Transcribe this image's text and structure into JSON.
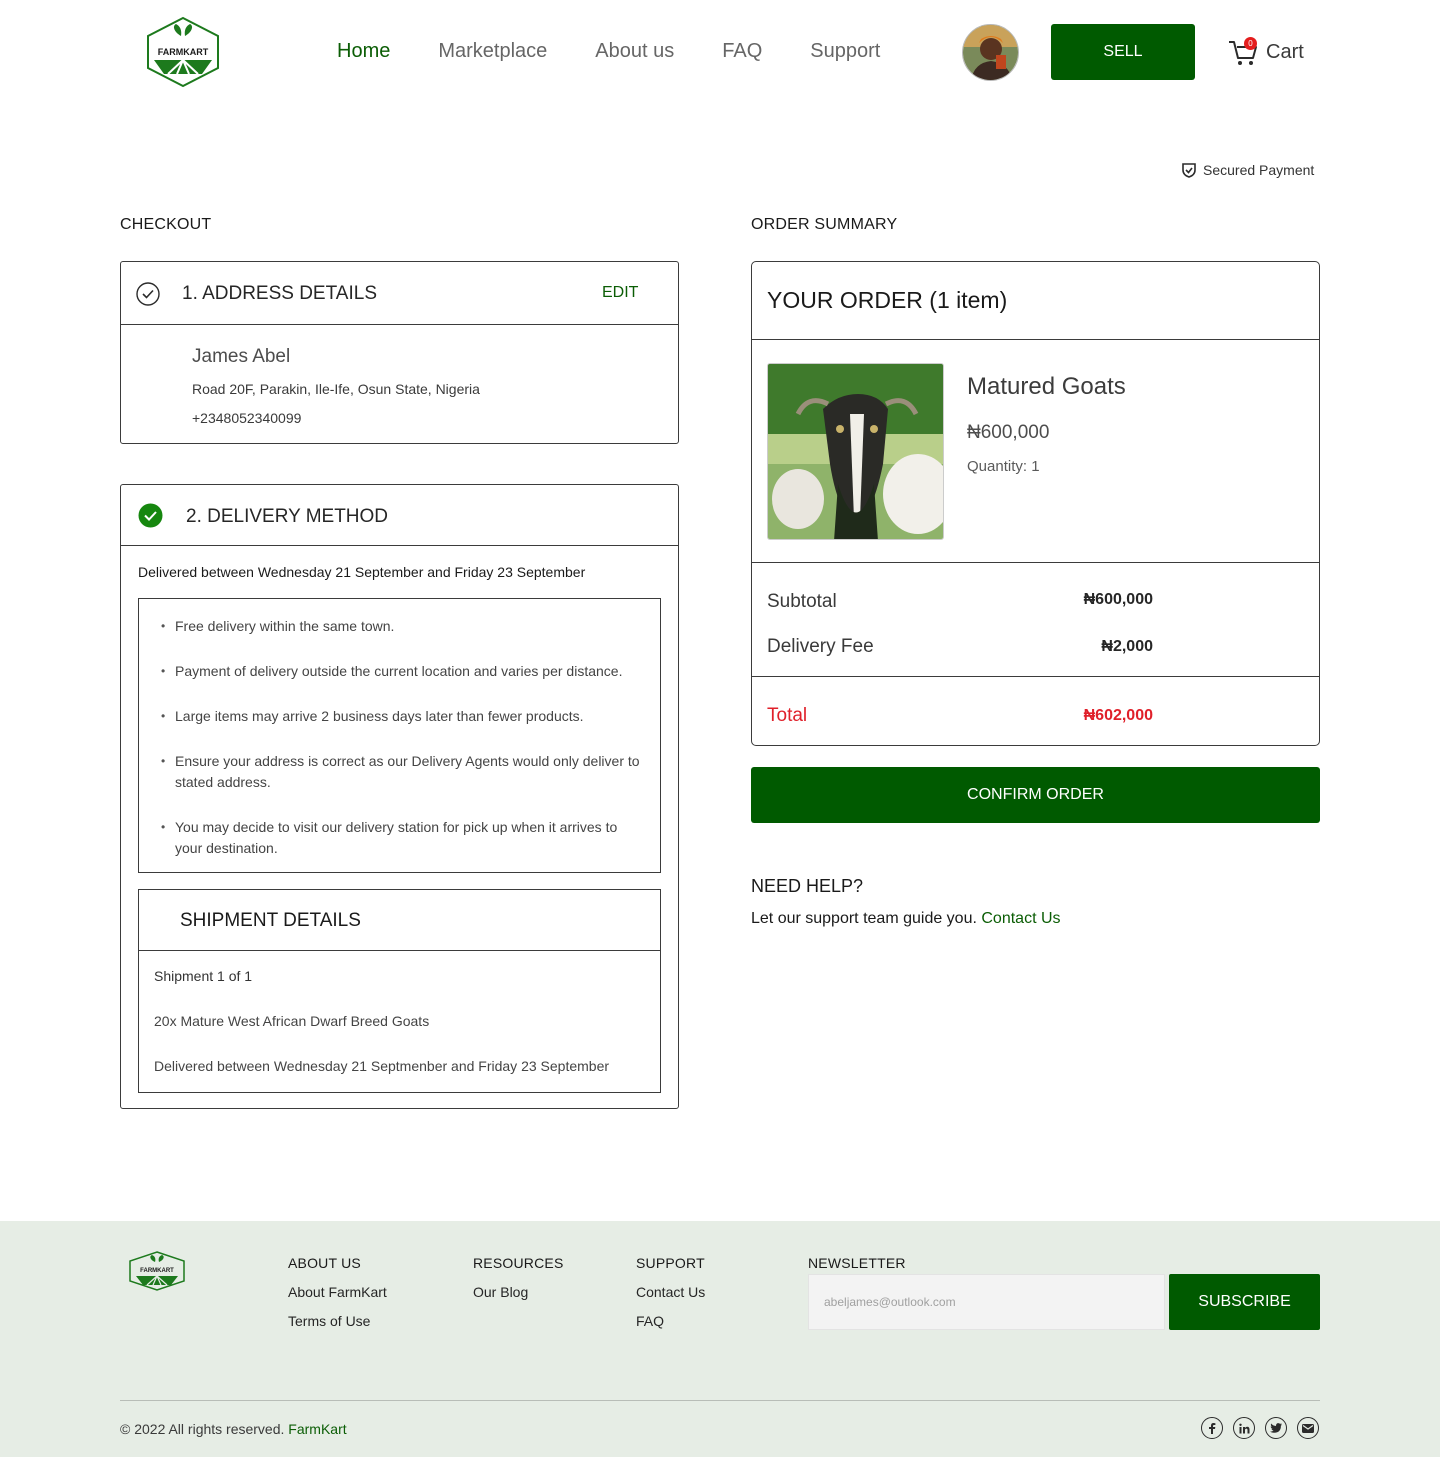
{
  "header": {
    "logo_text": "FARMKART",
    "nav": [
      {
        "label": "Home",
        "active": true
      },
      {
        "label": "Marketplace",
        "active": false
      },
      {
        "label": "About us",
        "active": false
      },
      {
        "label": "FAQ",
        "active": false
      },
      {
        "label": "Support",
        "active": false
      }
    ],
    "sell_label": "SELL",
    "cart_label": "Cart",
    "cart_count": "0"
  },
  "secured_payment": "Secured Payment",
  "checkout": {
    "title": "CHECKOUT",
    "address": {
      "step_title": "1.  ADDRESS DETAILS",
      "edit_label": "EDIT",
      "name": "James Abel",
      "street": "Road 20F, Parakin, Ile-Ife, Osun State, Nigeria",
      "phone": "+2348052340099"
    },
    "delivery": {
      "step_title": "2. DELIVERY METHOD",
      "window": "Delivered between Wednesday 21 September and Friday 23 September",
      "notes": [
        "Free delivery within the same town.",
        "Payment of delivery outside the current location and varies per distance.",
        "Large items may arrive 2 business days later than fewer products.",
        "Ensure your address is correct as our Delivery Agents would only deliver to stated address.",
        "You may decide to visit our delivery station for pick up when it arrives to your destination."
      ],
      "shipment": {
        "title": "SHIPMENT DETAILS",
        "count": "Shipment 1 of 1",
        "item": "20x Mature West African Dwarf Breed Goats",
        "window": "Delivered between Wednesday 21 Septmenber and Friday 23 September"
      }
    }
  },
  "summary": {
    "title": "ORDER SUMMARY",
    "order_title": "YOUR ORDER (1 item)",
    "product": {
      "name": "Matured Goats",
      "price": "₦600,000",
      "quantity": "Quantity: 1"
    },
    "subtotal_label": "Subtotal",
    "subtotal_value": "₦600,000",
    "delivery_label": "Delivery Fee",
    "delivery_value": "₦2,000",
    "total_label": "Total",
    "total_value": "₦602,000",
    "confirm_label": "CONFIRM ORDER"
  },
  "help": {
    "title": "NEED HELP?",
    "text": "Let our support team guide you.",
    "link": "Contact Us"
  },
  "footer": {
    "logo_text": "FARMKART",
    "about": {
      "heading": "ABOUT US",
      "links": [
        "About FarmKart",
        "Terms of Use"
      ]
    },
    "resources": {
      "heading": "RESOURCES",
      "links": [
        "Our Blog"
      ]
    },
    "support": {
      "heading": "SUPPORT",
      "links": [
        "Contact Us",
        "FAQ"
      ]
    },
    "newsletter": {
      "heading": "NEWSLETTER",
      "placeholder": "abeljames@outlook.com",
      "button": "SUBSCRIBE"
    },
    "copyright": "© 2022 All rights reserved.",
    "brand": "FarmKart",
    "socials": [
      "facebook-icon",
      "linkedin-icon",
      "twitter-icon",
      "email-icon"
    ]
  },
  "colors": {
    "brand_green": "#005a00",
    "link_green": "#0b5d05",
    "total_red": "#e0202a",
    "footer_bg": "#e6ede5"
  }
}
